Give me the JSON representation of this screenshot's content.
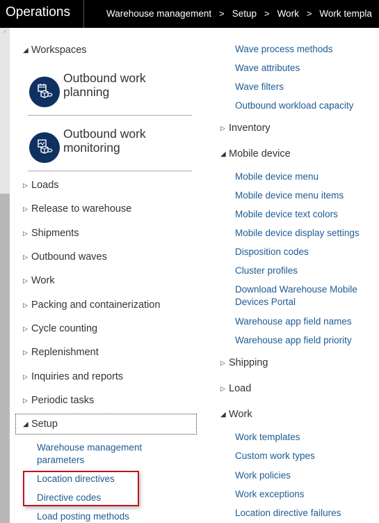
{
  "header": {
    "app_title": "Operations",
    "breadcrumb": [
      "Warehouse management",
      "Setup",
      "Work",
      "Work templa"
    ],
    "breadcrumb_separator": ">"
  },
  "left_column": {
    "workspaces": {
      "label": "Workspaces",
      "expanded": true,
      "tiles": [
        {
          "line1": "Outbound work",
          "line2": "planning",
          "icon": "calendar-box-icon"
        },
        {
          "line1": "Outbound work",
          "line2": "monitoring",
          "icon": "chart-box-icon"
        }
      ]
    },
    "groups": [
      {
        "label": "Loads",
        "expanded": false
      },
      {
        "label": "Release to warehouse",
        "expanded": false
      },
      {
        "label": "Shipments",
        "expanded": false
      },
      {
        "label": "Outbound waves",
        "expanded": false
      },
      {
        "label": "Work",
        "expanded": false
      },
      {
        "label": "Packing and containerization",
        "expanded": false
      },
      {
        "label": "Cycle counting",
        "expanded": false
      },
      {
        "label": "Replenishment",
        "expanded": false
      },
      {
        "label": "Inquiries and reports",
        "expanded": false
      },
      {
        "label": "Periodic tasks",
        "expanded": false
      }
    ],
    "setup": {
      "label": "Setup",
      "expanded": true,
      "links": [
        {
          "line1": "Warehouse management",
          "line2": "parameters"
        },
        {
          "line1": "Location directives"
        },
        {
          "line1": "Directive codes"
        },
        {
          "line1": "Load posting methods"
        }
      ]
    }
  },
  "right_column": {
    "top_links": [
      "Wave process methods",
      "Wave attributes",
      "Wave filters",
      "Outbound workload capacity"
    ],
    "inventory": {
      "label": "Inventory",
      "expanded": false
    },
    "mobile_device": {
      "label": "Mobile device",
      "expanded": true,
      "links": [
        "Mobile device menu",
        "Mobile device menu items",
        "Mobile device text colors",
        "Mobile device display settings",
        "Disposition codes",
        "Cluster profiles",
        "Download Warehouse Mobile",
        "Devices Portal",
        "Warehouse app field names",
        "Warehouse app field priority"
      ]
    },
    "shipping": {
      "label": "Shipping",
      "expanded": false
    },
    "load": {
      "label": "Load",
      "expanded": false
    },
    "work": {
      "label": "Work",
      "expanded": true,
      "links": [
        "Work templates",
        "Custom work types",
        "Work policies",
        "Work exceptions",
        "Location directive failures"
      ]
    }
  },
  "icons": {
    "collapsed": "▷",
    "expanded": "◢",
    "scroll_up": "^"
  },
  "colors": {
    "link": "#1e5b94",
    "tile_circle": "#0f3161",
    "highlight_border": "#c0121b",
    "topbar": "#000000"
  }
}
